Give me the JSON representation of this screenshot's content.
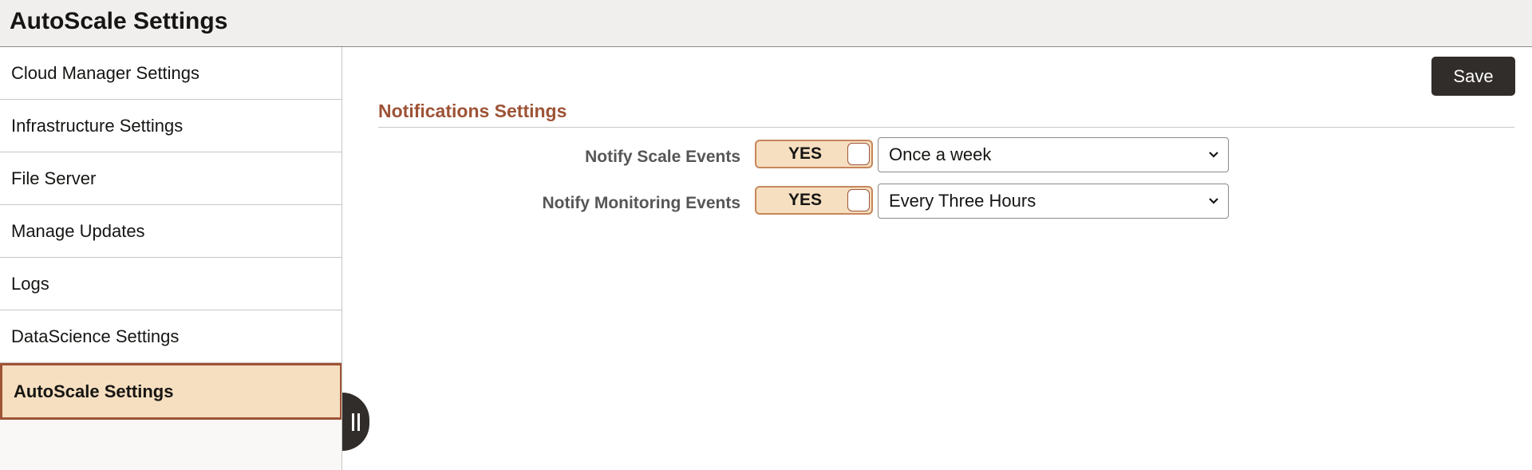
{
  "header": {
    "title": "AutoScale Settings"
  },
  "sidebar": {
    "items": [
      {
        "label": "Cloud Manager Settings",
        "active": false
      },
      {
        "label": "Infrastructure Settings",
        "active": false
      },
      {
        "label": "File Server",
        "active": false
      },
      {
        "label": "Manage Updates",
        "active": false
      },
      {
        "label": "Logs",
        "active": false
      },
      {
        "label": "DataScience Settings",
        "active": false
      },
      {
        "label": "AutoScale Settings",
        "active": true
      }
    ]
  },
  "toolbar": {
    "save_label": "Save"
  },
  "section": {
    "title": "Notifications Settings"
  },
  "fields": [
    {
      "label": "Notify Scale Events",
      "toggle_text": "YES",
      "toggle_on": true,
      "select_value": "Once a week"
    },
    {
      "label": "Notify Monitoring Events",
      "toggle_text": "YES",
      "toggle_on": true,
      "select_value": "Every Three Hours"
    }
  ],
  "icons": {
    "collapse": "pause-bars-icon",
    "dropdown": "chevron-down-icon"
  },
  "colors": {
    "accent": "#9e5336",
    "active_bg": "#f6dfc0",
    "dark": "#312d2a"
  }
}
